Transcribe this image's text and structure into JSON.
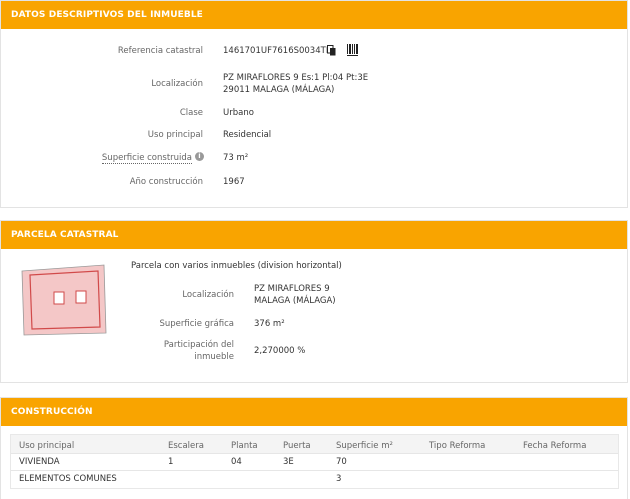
{
  "datos": {
    "title": "DATOS DESCRIPTIVOS DEL INMUEBLE",
    "referencia_label": "Referencia catastral",
    "referencia_value": "1461701UF7616S0034TL",
    "localizacion_label": "Localización",
    "localizacion_line1": "PZ MIRAFLORES 9 Es:1 Pl:04 Pt:3E",
    "localizacion_line2": "29011 MALAGA (MÁLAGA)",
    "clase_label": "Clase",
    "clase_value": "Urbano",
    "uso_label": "Uso principal",
    "uso_value": "Residencial",
    "superficie_label": "Superficie construida",
    "superficie_value": "73 m²",
    "anio_label": "Año construcción",
    "anio_value": "1967",
    "icons": [
      "copy-icon",
      "barcode-icon",
      "info-icon"
    ]
  },
  "parcela": {
    "title": "PARCELA CATASTRAL",
    "description": "Parcela con varios inmuebles (division horizontal)",
    "localizacion_label": "Localización",
    "localizacion_line1": "PZ MIRAFLORES 9",
    "localizacion_line2": "MALAGA (MÁLAGA)",
    "superficie_label": "Superficie gráfica",
    "superficie_value": "376 m²",
    "participacion_label_1": "Participación del",
    "participacion_label_2": "inmueble",
    "participacion_value": "2,270000 %"
  },
  "construccion": {
    "title": "CONSTRUCCIÓN",
    "headers": [
      "Uso principal",
      "Escalera",
      "Planta",
      "Puerta",
      "Superficie m²",
      "Tipo Reforma",
      "Fecha Reforma"
    ],
    "rows": [
      [
        "VIVIENDA",
        "1",
        "04",
        "3E",
        "70",
        "",
        ""
      ],
      [
        "ELEMENTOS COMUNES",
        "",
        "",
        "",
        "3",
        "",
        ""
      ]
    ]
  },
  "colors": {
    "header_bg": "#f9a400",
    "parcel_fill": "#f4c7c7",
    "parcel_stroke": "#d14a4a"
  }
}
